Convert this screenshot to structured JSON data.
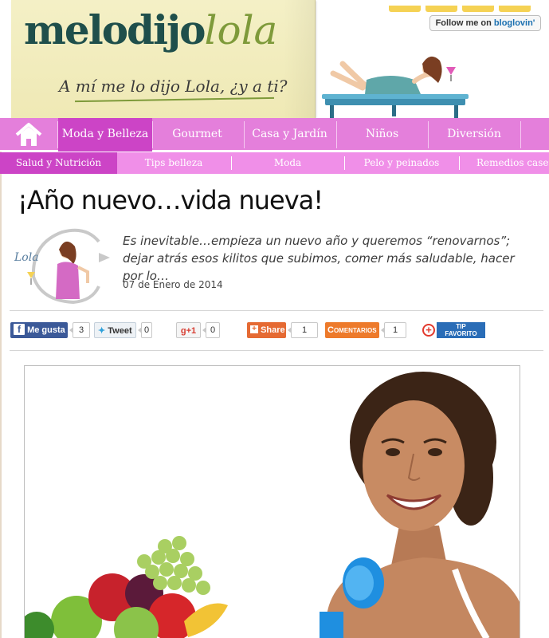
{
  "header": {
    "logo_main": "melodijo",
    "logo_accent": "lola",
    "tagline": "A mí me lo dijo Lola, ¿y a ti?",
    "follow_prefix": "Follow me on ",
    "follow_brand": "bloglovin'"
  },
  "mainnav": {
    "items": [
      {
        "label": "Moda y Belleza",
        "active": true
      },
      {
        "label": "Gourmet"
      },
      {
        "label": "Casa y Jardín"
      },
      {
        "label": "Niños"
      },
      {
        "label": "Diversión"
      }
    ]
  },
  "subnav": {
    "items": [
      {
        "label": "Salud y Nutrición",
        "active": true
      },
      {
        "label": "Tips belleza"
      },
      {
        "label": "Moda"
      },
      {
        "label": "Pelo y peinados"
      },
      {
        "label": "Remedios caseros"
      }
    ]
  },
  "article": {
    "title": "¡Año nuevo…vida nueva!",
    "avatar_label": "Lola",
    "excerpt": "Es inevitable…empieza un nuevo año y queremos “renovarnos”; dejar atrás esos kilitos que subimos, comer más saludable, hacer por lo…",
    "date": "07 de Enero de 2014"
  },
  "share": {
    "like_label": "Me gusta",
    "like_count": "3",
    "tweet_label": "Tweet",
    "tweet_count": "0",
    "gplus_label": "+1",
    "gplus_count": "0",
    "share_label": "Share",
    "share_count": "1",
    "comments_label": "Comentarios",
    "comments_count": "1",
    "tip_line1": "TIP",
    "tip_line2": "FAVORITO"
  },
  "colors": {
    "nav_bg": "#e47fdb",
    "nav_active": "#cc44c6",
    "subnav_bg": "#f08fe8",
    "facebook": "#3b5998",
    "share_orange": "#e56a33",
    "comments_orange": "#ed7a2b",
    "tip_blue": "#2a6db7"
  }
}
